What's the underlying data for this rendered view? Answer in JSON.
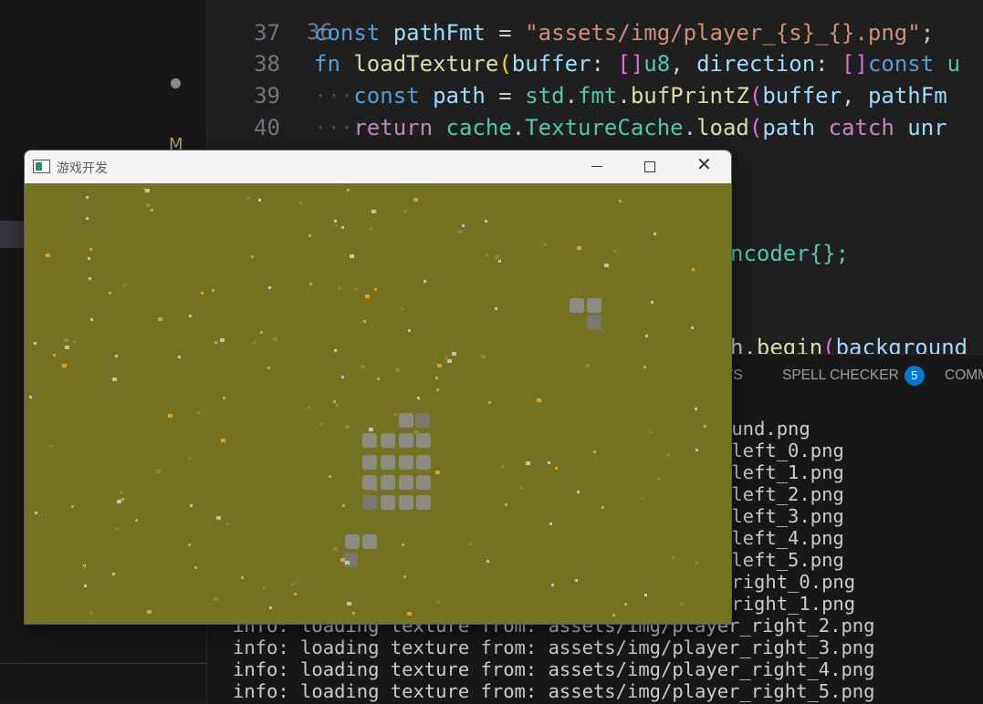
{
  "editor": {
    "lines": [
      {
        "num": "36"
      },
      {
        "num": "37",
        "kw": "const",
        "name": "pathFmt",
        "op": " = ",
        "str": "\"assets/img/player_{s}_{}.png\"",
        "end": ";"
      },
      {
        "num": "38",
        "kw": "fn",
        "name": "loadTexture",
        "p1": "buffer",
        "t1": "u8",
        "p2": "direction",
        "kw2": "const",
        "t2": "u"
      },
      {
        "num": "39",
        "kw": "const",
        "name": "path",
        "ns": "std",
        "mod": "fmt",
        "call": "bufPrintZ",
        "arg": "buffer",
        "arg2": "pathFm"
      },
      {
        "num": "40",
        "kw": "return",
        "ns": "cache",
        "ty": "TextureCache",
        "call": "load",
        "arg": "path",
        "kw2": "catch",
        "arg2": "unr"
      },
      {
        "fragment": "ncoder{};"
      },
      {
        "fragment_a": "h.",
        "call": "begin",
        "arg": "background"
      }
    ]
  },
  "panel": {
    "tabs": [
      {
        "label": "RTS"
      },
      {
        "label": "SPELL CHECKER",
        "badge": "5"
      },
      {
        "label": "COMM"
      }
    ],
    "log": [
      "ound.png",
      "_left_0.png",
      "_left_1.png",
      "_left_2.png",
      "_left_3.png",
      "_left_4.png",
      "_left_5.png",
      "_right_0.png",
      "_right_1.png",
      "info: loading texture from: assets/img/player_right_2.png",
      "info: loading texture from: assets/img/player_right_3.png",
      "info: loading texture from: assets/img/player_right_4.png",
      "info: loading texture from: assets/img/player_right_5.png"
    ]
  },
  "sidebar": {
    "modified_marker": "M"
  },
  "game_window": {
    "title": "游戏开发",
    "icons": {
      "app": "app-window-icon",
      "minimize": "minimize-icon",
      "maximize": "maximize-icon",
      "close": "close-icon"
    },
    "colors": {
      "grass": "#737321",
      "stone": "#8d8c82",
      "tuft_light": "#c9c3a8",
      "tuft_gold": "#d9a130",
      "tuft_green": "#8c8a3a"
    }
  }
}
